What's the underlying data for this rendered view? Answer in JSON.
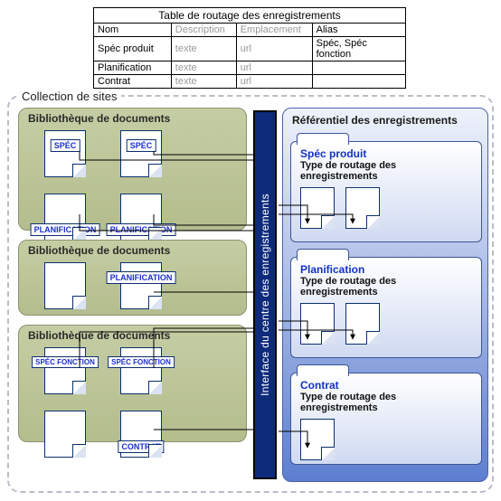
{
  "routing_table": {
    "title": "Table de routage des enregistrements",
    "headers": {
      "name": "Nom",
      "description": "Description",
      "location": "Emplacement",
      "alias": "Alias"
    },
    "rows": [
      {
        "name": "Spéc produit",
        "description": "texte",
        "location": "url",
        "alias": "Spéc, Spéc fonction"
      },
      {
        "name": "Planification",
        "description": "texte",
        "location": "url",
        "alias": ""
      },
      {
        "name": "Contrat",
        "description": "texte",
        "location": "url",
        "alias": ""
      }
    ]
  },
  "collection": {
    "title": "Collection de sites",
    "interface_label": "Interface du centre des enregistrements",
    "libraries": [
      {
        "title": "Bibliothèque de documents",
        "docs": [
          {
            "label": "SPÉC",
            "pos": "top"
          },
          {
            "label": "SPÉC",
            "pos": "top"
          },
          {
            "label": "PLANIFICATION",
            "pos": "bottom"
          },
          {
            "label": "PLANIFICATION",
            "pos": "bottom"
          }
        ]
      },
      {
        "title": "Bibliothèque de documents",
        "docs": [
          {
            "label": "",
            "pos": ""
          },
          {
            "label": "PLANIFICATION",
            "pos": "top"
          }
        ]
      },
      {
        "title": "Bibliothèque de documents",
        "docs": [
          {
            "label": "SPÉC FONCTION",
            "pos": "top"
          },
          {
            "label": "SPÉC FONCTION",
            "pos": "top"
          },
          {
            "label": "",
            "pos": ""
          },
          {
            "label": "CONTRAT",
            "pos": "bottom"
          }
        ]
      }
    ],
    "referential": {
      "title": "Référentiel des enregistrements",
      "folders": [
        {
          "title": "Spéc produit",
          "subtitle": "Type de routage des enregistrements",
          "doc_count": 2
        },
        {
          "title": "Planification",
          "subtitle": "Type de routage des enregistrements",
          "doc_count": 2
        },
        {
          "title": "Contrat",
          "subtitle": "Type de routage des enregistrements",
          "doc_count": 1
        }
      ]
    }
  }
}
